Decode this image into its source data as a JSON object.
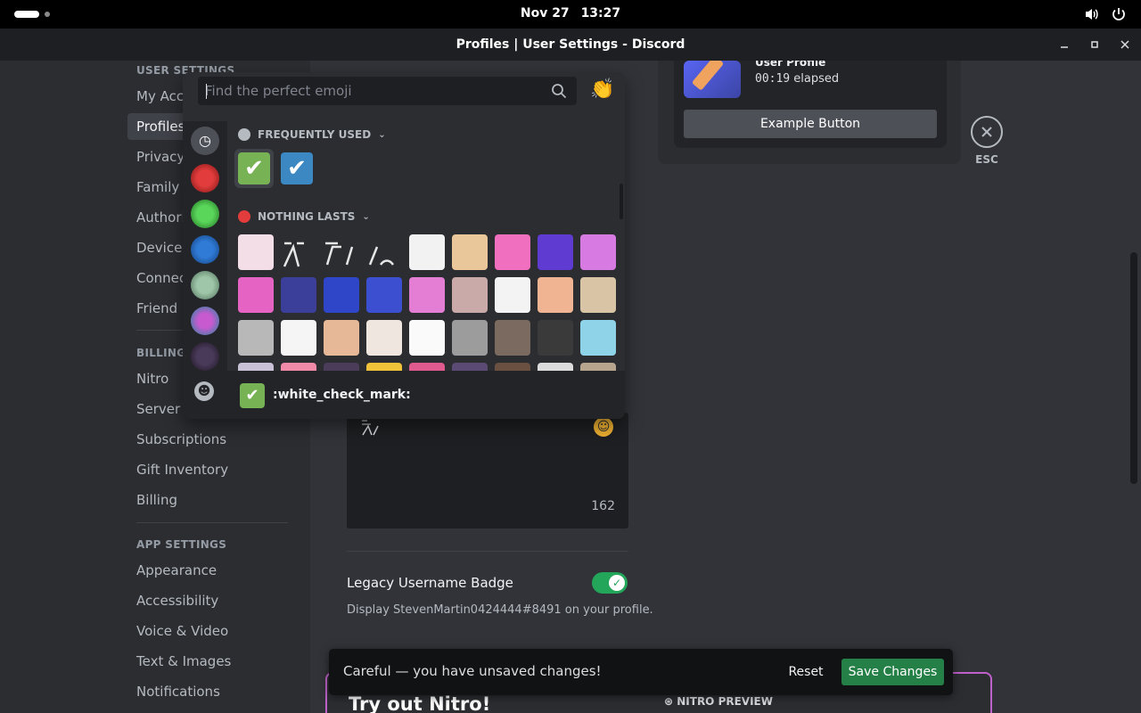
{
  "system_bar": {
    "date": "Nov 27",
    "time": "13:27"
  },
  "window": {
    "title": "Profiles | User Settings - Discord"
  },
  "sidebar": {
    "user_settings_header": "USER SETTINGS",
    "user_items": [
      {
        "label": "My Account"
      },
      {
        "label": "Profiles"
      },
      {
        "label": "Privacy & Safety"
      },
      {
        "label": "Family Centre"
      },
      {
        "label": "Authorised Apps"
      },
      {
        "label": "Devices"
      },
      {
        "label": "Connections"
      },
      {
        "label": "Friend Requests"
      }
    ],
    "billing_header": "BILLING SETTINGS",
    "billing_items": [
      {
        "label": "Nitro"
      },
      {
        "label": "Server Boost"
      },
      {
        "label": "Subscriptions"
      },
      {
        "label": "Gift Inventory"
      },
      {
        "label": "Billing"
      }
    ],
    "app_header": "APP SETTINGS",
    "app_items": [
      {
        "label": "Appearance"
      },
      {
        "label": "Accessibility"
      },
      {
        "label": "Voice & Video"
      },
      {
        "label": "Text & Images"
      },
      {
        "label": "Notifications"
      }
    ],
    "selected": "Profiles"
  },
  "preview": {
    "activity_label": "User Profile",
    "elapsed_time": "00:19",
    "elapsed_suffix": "elapsed",
    "example_button": "Example Button"
  },
  "esc": {
    "label": "ESC"
  },
  "emoji_picker": {
    "search_placeholder": "Find the perfect emoji",
    "search_value": "",
    "frequently_used_label": "FREQUENTLY USED",
    "server_section_label": "NOTHING LASTS",
    "hover_emoji_name": ":white_check_mark:",
    "frequently_used": [
      {
        "name": "white_check_mark",
        "glyph": "✔",
        "color": "#77b255"
      },
      {
        "name": "ballot_box_with_check",
        "glyph": "✔",
        "color": "#3b88c3"
      }
    ]
  },
  "about_me": {
    "char_count": "162"
  },
  "legacy_badge": {
    "title": "Legacy Username Badge",
    "description": "Display StevenMartin0424444#8491 on your profile.",
    "enabled": true
  },
  "unsaved_bar": {
    "message": "Careful — you have unsaved changes!",
    "reset_label": "Reset",
    "save_label": "Save Changes"
  },
  "nitro": {
    "title": "Try out Nitro!",
    "preview_label": "NITRO PREVIEW"
  },
  "colors": {
    "accent_green": "#23a55a",
    "save_green": "#248046",
    "nitro_border": "#c061cb",
    "check_green": "#77b255",
    "check_blue": "#3b88c3"
  }
}
